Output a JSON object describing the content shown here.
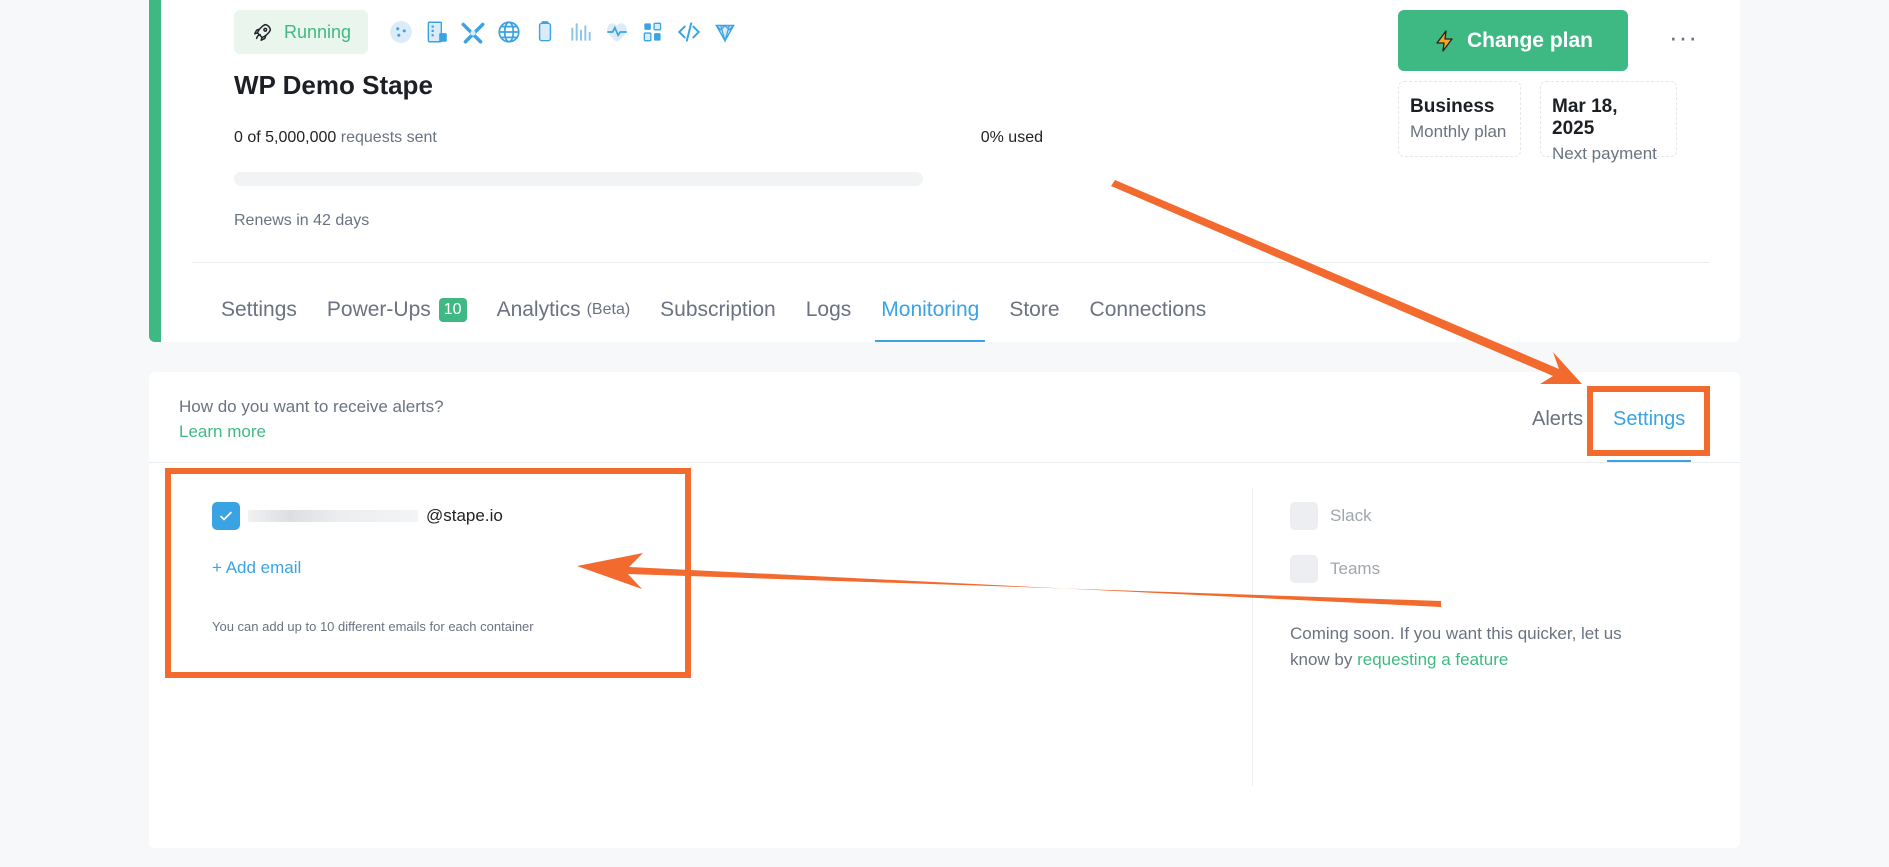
{
  "container": {
    "status": "Running",
    "title": "WP Demo Stape",
    "requests_count": "0 of 5,000,000",
    "requests_suffix": "requests sent",
    "used": "0% used",
    "usage_fraction": 0,
    "renews": "Renews in 42 days",
    "powerup_icons": [
      "cookie-icon",
      "server-icon",
      "cross-tools-icon",
      "globe-icon",
      "cylinder-icon",
      "bars-icon",
      "heartbeat-icon",
      "bucket-icon",
      "code-icon",
      "diamond-icon"
    ]
  },
  "plan": {
    "change_label": "Change plan",
    "name": "Business",
    "name_sub": "Monthly plan",
    "next_payment": "Mar 18, 2025",
    "next_payment_sub": "Next payment"
  },
  "tabs": {
    "settings": "Settings",
    "powerups": "Power-Ups",
    "powerups_badge": "10",
    "analytics": "Analytics",
    "analytics_beta": "(Beta)",
    "subscription": "Subscription",
    "logs": "Logs",
    "monitoring": "Monitoring",
    "store": "Store",
    "connections": "Connections"
  },
  "monitoring": {
    "question": "How do you want to receive alerts?",
    "learn_more": "Learn more",
    "tab_alerts": "Alerts",
    "tab_settings": "Settings",
    "email_domain": "@stape.io",
    "add_email": "+ Add email",
    "email_note": "You can add up to 10 different emails for each container",
    "slack": "Slack",
    "teams": "Teams",
    "coming_soon": "Coming soon. If you want this quicker, let us know by",
    "request_link": "requesting a feature"
  },
  "colors": {
    "accent_green": "#3fb984",
    "accent_blue": "#3aa3e3",
    "annotation": "#f26a2e"
  }
}
